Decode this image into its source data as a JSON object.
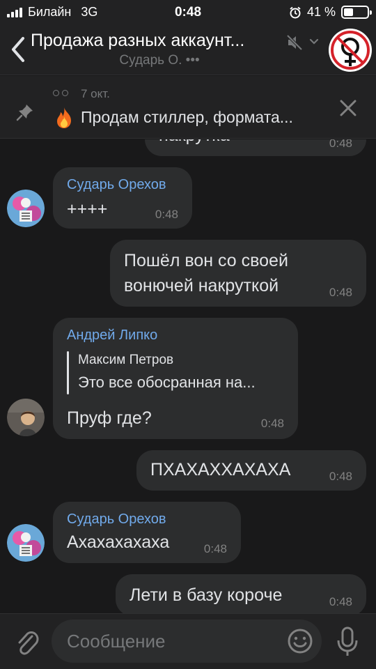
{
  "status_bar": {
    "carrier": "Билайн",
    "network": "3G",
    "time": "0:48",
    "battery": "41 %",
    "battery_level": 0.41
  },
  "header": {
    "title": "Продажа разных аккаунт...",
    "subtitle": "Сударь О. •••"
  },
  "pinned": {
    "date": "7 окт.",
    "text": "Продам стиллер, формата..."
  },
  "messages": [
    {
      "id": "m0",
      "direction": "out",
      "text": "накрутка",
      "time": "0:48"
    },
    {
      "id": "m1",
      "direction": "in",
      "author": "Сударь Орехов",
      "text": "++++",
      "time": "0:48"
    },
    {
      "id": "m2",
      "direction": "out",
      "lines": [
        "Пошёл вон со своей",
        "вонючей накруткой"
      ],
      "time": "0:48"
    },
    {
      "id": "m3",
      "direction": "in",
      "author": "Андрей Липко",
      "reply_author": "Максим Петров",
      "reply_text": "Это все обосранная на...",
      "text": "Пруф где?",
      "time": "0:48"
    },
    {
      "id": "m4",
      "direction": "out",
      "text": "ПХАХАХХАХАХА",
      "time": "0:48"
    },
    {
      "id": "m5",
      "direction": "in",
      "author": "Сударь Орехов",
      "text": "Ахахахахаха",
      "time": "0:48"
    },
    {
      "id": "m6",
      "direction": "out",
      "text": "Лети в базу короче",
      "time": "0:48"
    }
  ],
  "input": {
    "placeholder": "Сообщение"
  },
  "colors": {
    "background": "#19191a",
    "bar": "#222223",
    "bubble": "#2c2d2e",
    "author": "#71aaeb",
    "text": "#e1e3e6",
    "secondary": "#76787a"
  }
}
